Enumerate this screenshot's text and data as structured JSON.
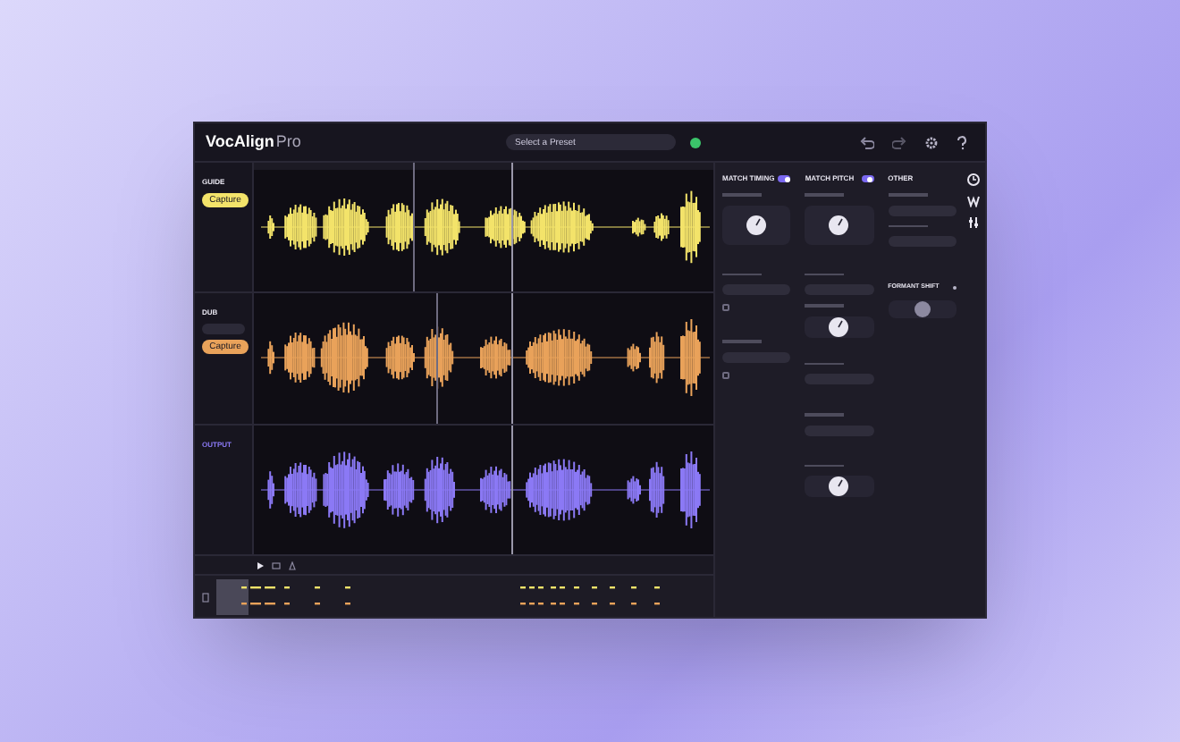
{
  "app": {
    "name": "VocAlign",
    "edition": "Pro"
  },
  "preset": {
    "placeholder": "Select a Preset"
  },
  "tracks": [
    {
      "label": "GUIDE",
      "button": "Capture",
      "color": "#f3e36a"
    },
    {
      "label": "DUB",
      "button": "Capture",
      "color": "#e9a25a"
    },
    {
      "label": "OUTPUT",
      "color": "#8b79f5"
    }
  ],
  "panels": [
    {
      "title": "MATCH TIMING",
      "on": true,
      "options": [
        {
          "checked": false
        },
        {
          "checked": false
        }
      ]
    },
    {
      "title": "MATCH PITCH",
      "on": true
    },
    {
      "title": "OTHER"
    }
  ],
  "formant": {
    "title": "FORMANT SHIFT"
  }
}
